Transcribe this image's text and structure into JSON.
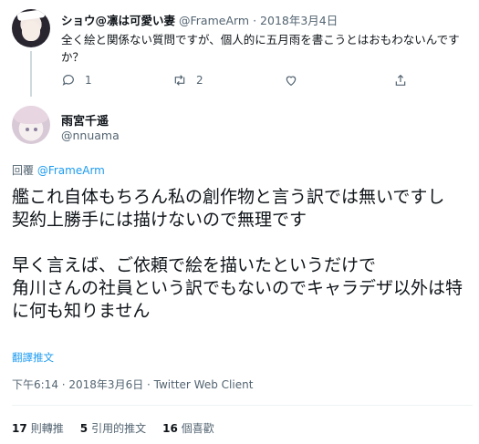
{
  "parent_tweet": {
    "display_name": "ショウ@凛は可愛い妻",
    "handle": "@FrameArm",
    "date": "2018年3月4日",
    "text": "全く絵と関係ない質問ですが、個人的に五月雨を書こうとはおもわないんですか？",
    "actions": {
      "reply_count": "1",
      "retweet_count": "2",
      "icons": [
        "reply-icon",
        "retweet-icon",
        "like-icon",
        "share-icon"
      ]
    }
  },
  "tweet": {
    "display_name": "雨宮千遥",
    "handle": "@nnuama",
    "reply_prefix": "回覆",
    "reply_to": "@FrameArm",
    "lines": [
      "艦これ自体もちろん私の創作物と言う訳では無いですし",
      "契約上勝手には描けないので無理です",
      "",
      "早く言えば、ご依頼で絵を描いたというだけで",
      "角川さんの社員という訳でもないのでキャラデザ以外は特に何も知りません"
    ],
    "translate_label": "翻譯推文",
    "meta": "下午6:14 · 2018年3月6日 · Twitter Web Client",
    "stats": {
      "retweets_value": "17",
      "retweets_label": "則轉推",
      "quotes_value": "5",
      "quotes_label": "引用的推文",
      "likes_value": "16",
      "likes_label": "個喜歡"
    }
  },
  "colors": {
    "link": "#1d9bf0",
    "secondary_text": "#536471",
    "primary_text": "#0f1419",
    "divider": "#eff3f4"
  }
}
